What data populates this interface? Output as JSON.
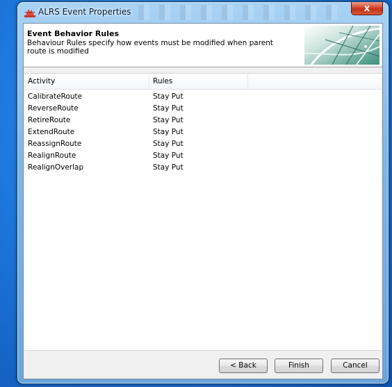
{
  "window": {
    "title": "ALRS Event Properties",
    "close_glyph": "x"
  },
  "header": {
    "title": "Event Behavior Rules",
    "description": "Behaviour Rules specify how events must be modified when parent route is modified"
  },
  "listview": {
    "columns": [
      "Activity",
      "Rules",
      ""
    ],
    "rows": [
      {
        "activity": "CalibrateRoute",
        "rule": "Stay Put"
      },
      {
        "activity": "ReverseRoute",
        "rule": "Stay Put"
      },
      {
        "activity": "RetireRoute",
        "rule": "Stay Put"
      },
      {
        "activity": "ExtendRoute",
        "rule": "Stay Put"
      },
      {
        "activity": "ReassignRoute",
        "rule": "Stay Put"
      },
      {
        "activity": "RealignRoute",
        "rule": "Stay Put"
      },
      {
        "activity": "RealignOverlap",
        "rule": "Stay Put"
      }
    ]
  },
  "buttons": {
    "back": "< Back",
    "finish": "Finish",
    "cancel": "Cancel"
  },
  "icons": {
    "app": "alrs-app-icon",
    "close": "close-icon"
  },
  "colors": {
    "desktop": "#1a6fd0",
    "close_button": "#c2321a",
    "dialog_bg": "#f0f0f0"
  }
}
